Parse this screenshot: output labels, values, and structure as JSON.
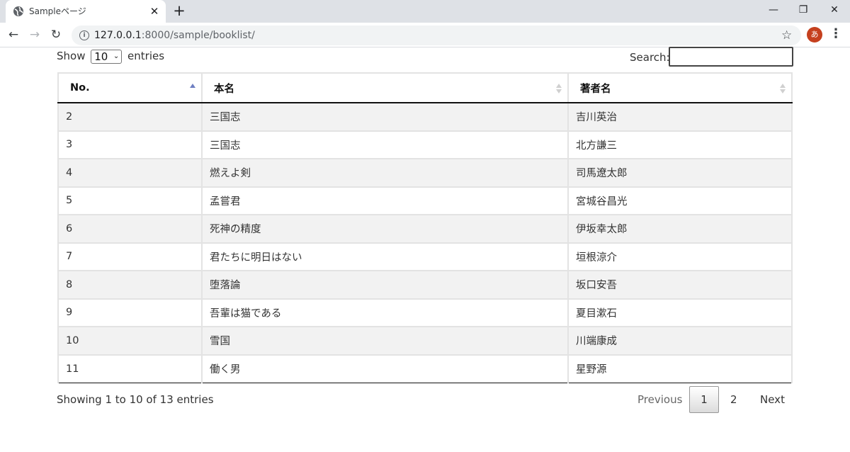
{
  "browser": {
    "tab_title": "Sampleページ",
    "url_host": "127.0.0.1",
    "url_rest": ":8000/sample/booklist/",
    "profile_initial": "あ"
  },
  "length_control": {
    "prefix": "Show",
    "value": "10",
    "suffix": "entries"
  },
  "search": {
    "label": "Search:",
    "value": ""
  },
  "table": {
    "columns": [
      "No.",
      "本名",
      "著者名"
    ],
    "sorted_column": "No.",
    "sort_direction": "ascending",
    "rows": [
      [
        "2",
        "三国志",
        "吉川英治"
      ],
      [
        "3",
        "三国志",
        "北方謙三"
      ],
      [
        "4",
        "燃えよ剣",
        "司馬遼太郎"
      ],
      [
        "5",
        "孟嘗君",
        "宮城谷昌光"
      ],
      [
        "6",
        "死神の精度",
        "伊坂幸太郎"
      ],
      [
        "7",
        "君たちに明日はない",
        "垣根涼介"
      ],
      [
        "8",
        "堕落論",
        "坂口安吾"
      ],
      [
        "9",
        "吾輩は猫である",
        "夏目漱石"
      ],
      [
        "10",
        "雪国",
        "川端康成"
      ],
      [
        "11",
        "働く男",
        "星野源"
      ]
    ]
  },
  "footer": {
    "info": "Showing 1 to 10 of 13 entries",
    "pagination": {
      "previous": "Previous",
      "pages": [
        "1",
        "2"
      ],
      "current": "1",
      "next": "Next"
    }
  },
  "colors": {
    "sort_active": "#6f7fc2",
    "profile": "#c5401e"
  }
}
